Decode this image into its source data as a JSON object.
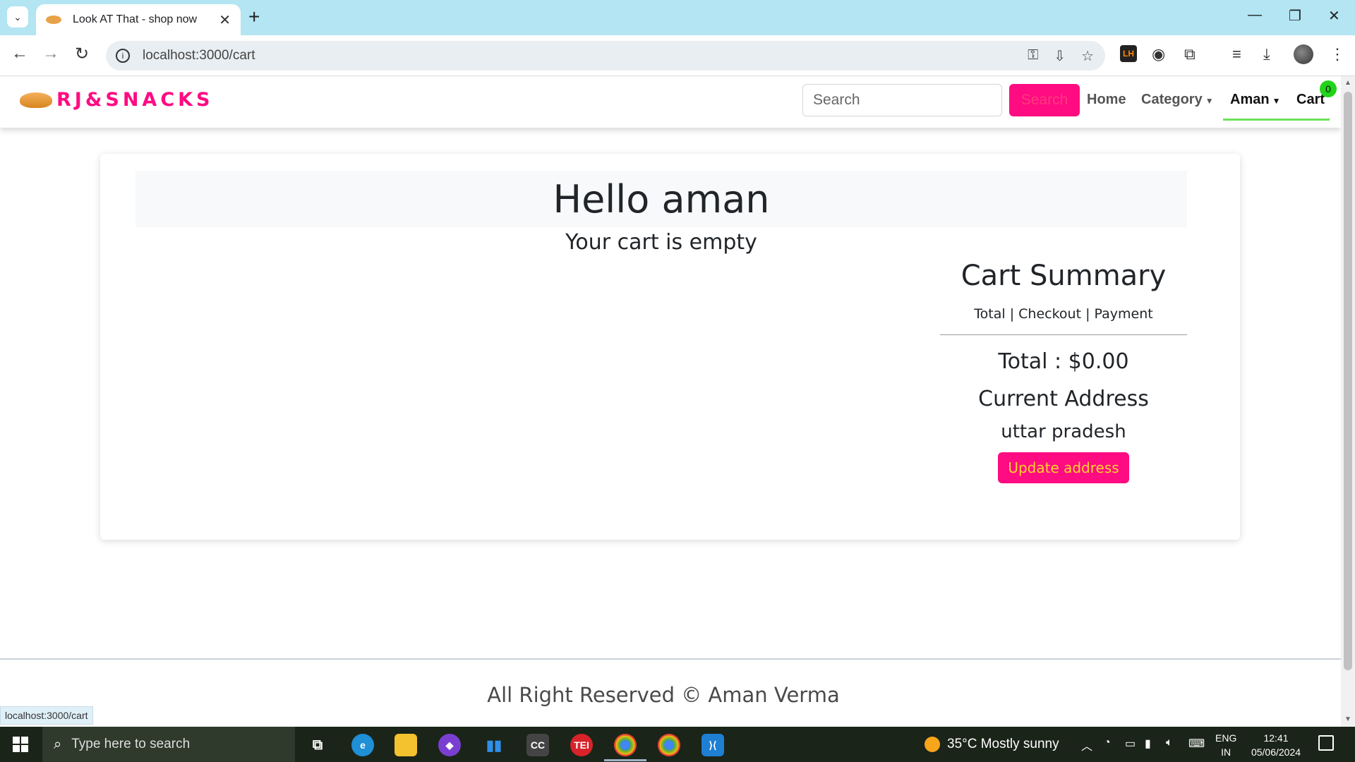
{
  "browser": {
    "tab_title": "Look AT That - shop now",
    "url": "localhost:3000/cart",
    "status_url": "localhost:3000/cart"
  },
  "navbar": {
    "brand": "RJ&SNACKS",
    "search_placeholder": "Search",
    "search_button": "Search",
    "links": {
      "home": "Home",
      "category": "Category",
      "user": "Aman",
      "cart": "Cart"
    },
    "cart_count": "0"
  },
  "cart": {
    "greeting": "Hello aman",
    "empty_message": "Your cart is empty"
  },
  "summary": {
    "title": "Cart Summary",
    "subtitle": "Total | Checkout | Payment",
    "total": "Total : $0.00",
    "address_label": "Current Address",
    "address_value": "uttar pradesh",
    "update_button": "Update address"
  },
  "footer": {
    "text": "All Right Reserved © Aman Verma"
  },
  "taskbar": {
    "search_placeholder": "Type here to search",
    "weather": "35°C  Mostly sunny",
    "lang_top": "ENG",
    "lang_bottom": "IN",
    "time": "12:41",
    "date": "05/06/2024"
  },
  "colors": {
    "brand": "#ff0b82",
    "badge": "#21d31b",
    "update_text": "#ffd32a"
  }
}
